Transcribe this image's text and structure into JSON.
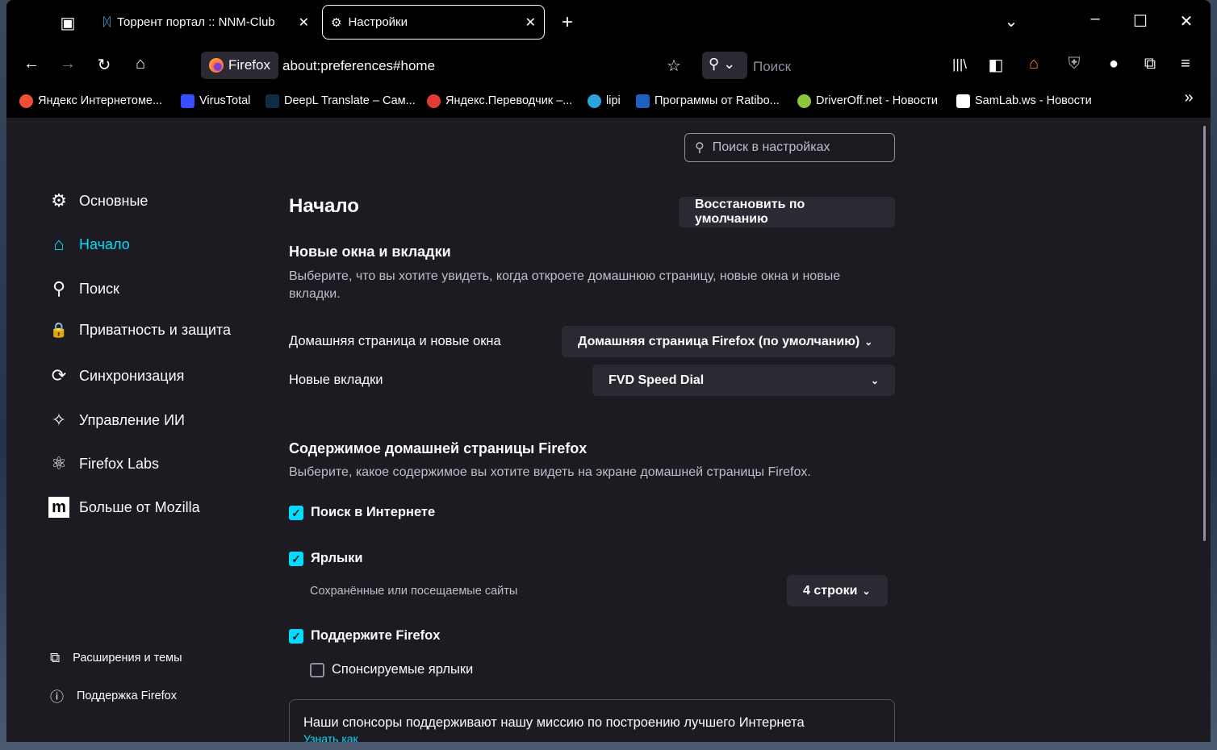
{
  "tabs": [
    {
      "label": "Торрент портал :: NNM-Club"
    },
    {
      "label": "Настройки"
    }
  ],
  "url": {
    "identity": "Firefox",
    "address": "about:preferences#home"
  },
  "search": {
    "placeholder": "Поиск"
  },
  "bookmarks": [
    {
      "label": "Яндекс Интернетоме...",
      "color": "#f04e36"
    },
    {
      "label": "VirusTotal",
      "color": "#394eff"
    },
    {
      "label": "DeepL Translate – Сам...",
      "color": "#0f2b46"
    },
    {
      "label": "Яндекс.Переводчик –...",
      "color": "#e03c31"
    },
    {
      "label": "lipi",
      "color": "#2aa3e0"
    },
    {
      "label": "Программы от Ratibo...",
      "color": "#1f5fbf"
    },
    {
      "label": "DriverOff.net - Новости",
      "color": "#8cc63f"
    },
    {
      "label": "SamLab.ws - Новости",
      "color": "#ffffff"
    }
  ],
  "prefs_search": {
    "placeholder": "Поиск в настройках"
  },
  "sidebar": {
    "items": [
      {
        "label": "Основные",
        "icon": "⚙"
      },
      {
        "label": "Начало",
        "icon": "⌂"
      },
      {
        "label": "Поиск",
        "icon": "⚲"
      },
      {
        "label": "Приватность и защита",
        "icon": "🔒"
      },
      {
        "label": "Синхронизация",
        "icon": "⟳"
      },
      {
        "label": "Управление ИИ",
        "icon": "✧"
      },
      {
        "label": "Firefox Labs",
        "icon": "⚛"
      },
      {
        "label": "Больше от Mozilla",
        "icon": "m"
      }
    ],
    "footer": [
      {
        "label": "Расширения и темы"
      },
      {
        "label": "Поддержка Firefox"
      }
    ]
  },
  "main": {
    "title": "Начало",
    "restore": "Восстановить по умолчанию",
    "new_windows": {
      "heading": "Новые окна и вкладки",
      "desc": "Выберите, что вы хотите увидеть, когда откроете домашнюю страницу, новые окна и новые вкладки.",
      "home_label": "Домашняя страница и новые окна",
      "home_value": "Домашняя страница Firefox (по умолчанию)",
      "tabs_label": "Новые вкладки",
      "tabs_value": "FVD Speed Dial"
    },
    "content": {
      "heading": "Содержимое домашней страницы Firefox",
      "desc": "Выберите, какое содержимое вы хотите видеть на экране домашней страницы Firefox.",
      "web_search": "Поиск в Интернете",
      "shortcuts": "Ярлыки",
      "shortcuts_desc": "Сохранённые или посещаемые сайты",
      "rows": "4 строки",
      "support": "Поддержите Firefox",
      "sponsored": "Спонсируемые ярлыки",
      "sponsor_text": "Наши спонсоры поддерживают нашу миссию по построению лучшего Интернета",
      "learn": "Узнать как"
    }
  }
}
